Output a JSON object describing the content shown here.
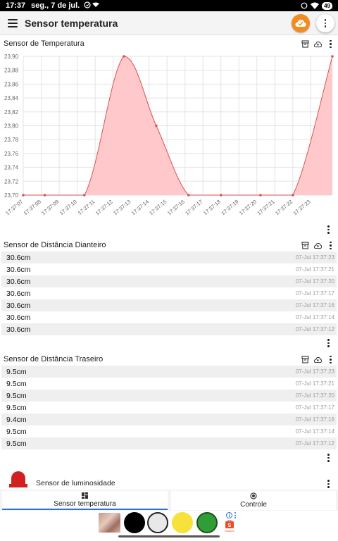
{
  "status_bar": {
    "time": "17:37",
    "date": "seg., 7 de jul.",
    "battery": "49"
  },
  "app_bar": {
    "title": "Sensor temperatura",
    "icons": [
      "menu-icon",
      "cloud-check-icon",
      "more-vert-icon"
    ]
  },
  "temperature_card": {
    "title": "Sensor de Temperatura",
    "icons": [
      "archive-icon",
      "cloud-upload-icon",
      "more-vert-icon"
    ]
  },
  "chart_data": {
    "type": "area",
    "title": "",
    "xlabel": "",
    "ylabel": "",
    "x": [
      "17:37:07",
      "17:37:08",
      "17:37:09",
      "17:37:10",
      "17:37:11",
      "17:37:12",
      "17:37:13",
      "17:37:14",
      "17:37:15",
      "17:37:16",
      "17:37:17",
      "17:37:18",
      "17:37:19",
      "17:37:20",
      "17:37:21",
      "17:37:22",
      "17:37:23"
    ],
    "points": [
      {
        "t": 7.0,
        "v": 23.7
      },
      {
        "t": 8.2,
        "v": 23.7
      },
      {
        "t": 10.4,
        "v": 23.7
      },
      {
        "t": 12.6,
        "v": 23.9
      },
      {
        "t": 14.4,
        "v": 23.8
      },
      {
        "t": 16.2,
        "v": 23.7
      },
      {
        "t": 18.0,
        "v": 23.7
      },
      {
        "t": 20.2,
        "v": 23.7
      },
      {
        "t": 22.0,
        "v": 23.7
      },
      {
        "t": 24.2,
        "v": 23.9
      }
    ],
    "xlim": [
      7.0,
      24.2
    ],
    "yticks": [
      "23,70",
      "23,72",
      "23,74",
      "23,76",
      "23,78",
      "23,80",
      "23,82",
      "23,84",
      "23,86",
      "23,88",
      "23,90"
    ],
    "ylim": [
      23.7,
      23.9
    ],
    "grid": true,
    "legend": "none",
    "line_color": "#d9534f",
    "fill_color": "#ffc9cc"
  },
  "front_distance_card": {
    "title": "Sensor de Distância Dianteiro",
    "icons": [
      "archive-icon",
      "cloud-upload-icon",
      "more-vert-icon"
    ],
    "rows": [
      {
        "value": "30.6cm",
        "time": "07-Jul 17:37:23"
      },
      {
        "value": "30.6cm",
        "time": "07-Jul 17:37:21"
      },
      {
        "value": "30.6cm",
        "time": "07-Jul 17:37:20"
      },
      {
        "value": "30.6cm",
        "time": "07-Jul 17:37:17"
      },
      {
        "value": "30.6cm",
        "time": "07-Jul 17:37:16"
      },
      {
        "value": "30.6cm",
        "time": "07-Jul 17:37:14"
      },
      {
        "value": "30.6cm",
        "time": "07-Jul 17:37:12"
      }
    ]
  },
  "rear_distance_card": {
    "title": "Sensor de Distância Traseiro",
    "icons": [
      "archive-icon",
      "cloud-upload-icon",
      "more-vert-icon"
    ],
    "rows": [
      {
        "value": "9.5cm",
        "time": "07-Jul 17:37:23"
      },
      {
        "value": "9.5cm",
        "time": "07-Jul 17:37:21"
      },
      {
        "value": "9.5cm",
        "time": "07-Jul 17:37:20"
      },
      {
        "value": "9.5cm",
        "time": "07-Jul 17:37:17"
      },
      {
        "value": "9.4cm",
        "time": "07-Jul 17:37:16"
      },
      {
        "value": "9.5cm",
        "time": "07-Jul 17:37:14"
      },
      {
        "value": "9.5cm",
        "time": "07-Jul 17:37:12"
      }
    ]
  },
  "luminosity_card": {
    "title": "Sensor de luminosidade",
    "icon": "red-light-icon"
  },
  "tabs": [
    {
      "label": "Sensor temperatura",
      "icon": "dashboard-icon",
      "active": true
    },
    {
      "label": "Controle",
      "icon": "radio-button-icon",
      "active": false
    }
  ],
  "ad_bar": {
    "circle_colors": [
      "#000000",
      "#e8e8e8",
      "#f6e23a",
      "#2f9e34"
    ],
    "brand_label": "Shopee",
    "brand_color": "#ee4d2d"
  },
  "colors": {
    "accent": "#f28c22",
    "tab_indicator": "#2f6fd6"
  }
}
